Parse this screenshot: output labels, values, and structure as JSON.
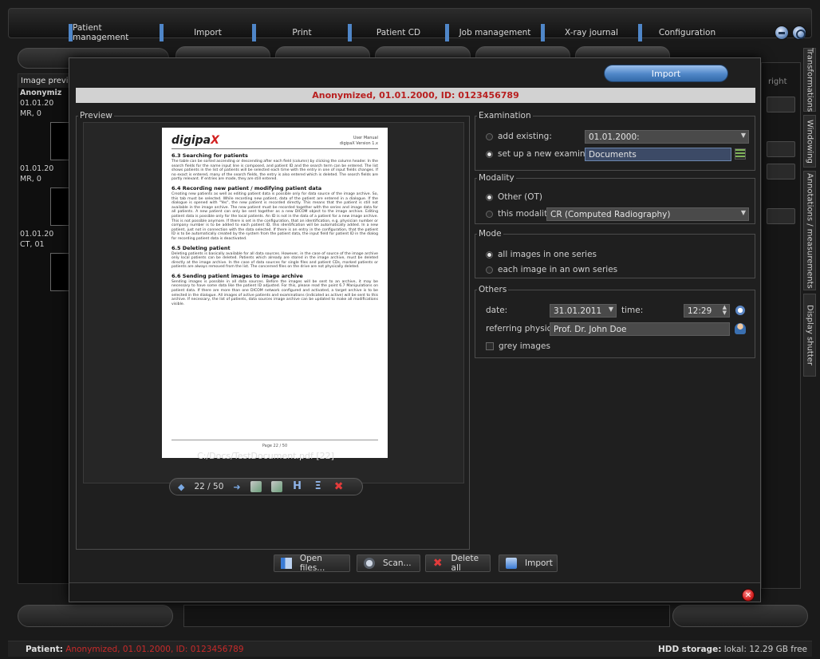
{
  "top_menu": {
    "items": [
      {
        "label": "Patient management"
      },
      {
        "label": "Import"
      },
      {
        "label": "Print"
      },
      {
        "label": "Patient CD"
      },
      {
        "label": "Job management"
      },
      {
        "label": "X-ray journal"
      },
      {
        "label": "Configuration"
      }
    ]
  },
  "left_panel": {
    "title": "Image preview",
    "items": [
      "Anonymiz",
      "01.01.20",
      "MR, 0",
      "01.01.20",
      "MR, 0",
      "01.01.20",
      "CT, 01"
    ]
  },
  "right_tabs": [
    "Transformations",
    "Windowing",
    "Annotations / measurements",
    "Display shutter"
  ],
  "right_panel_text": "right",
  "dialog": {
    "tab_label": "Import",
    "header": "Anonymized, 01.01.2000, ID: 0123456789",
    "preview": {
      "legend": "Preview",
      "file_path": "C:/Docs/TestDocument.pdf [22]",
      "page_indicator": "22 / 50",
      "document": {
        "logo_main": "digipa",
        "logo_x": "X",
        "header_right": "User Manual\ndigipaX Version 1.x",
        "sections": [
          {
            "title": "6.3 Searching for patients",
            "text": "The table can be sorted ascending or descending after each field (column) by clicking the column header. In the search fields for the name input line is composed, and patient ID and the search term can be entered. The list shows patients in the list of patients will be selected each time with the entry in one of input fields changes. If no exact is entered, many of the search fields, the entry is also entered which is deleted. The search fields are partly relevant. If entries are made, they are still entered."
          },
          {
            "title": "6.4 Recording new patient / modifying patient data",
            "text": "Creating new patients as well as editing patient data is possible only for data source of the image archive. So, this tab must be selected. While recording new patient, data of the patient are entered in a dialogue. If the dialogue is opened with \"Yes\", the new patient is recorded directly. This means that the patient is still not available in the image archive. The new patient must be recorded together with the series and image data for all patients. A new patient can only be sent together as a new DICOM object to the image archive. Editing patient data is possible only for the local patients. An ID is not in the data of a patient for a new image archive. This is not possible anymore. If there is set in the configuration, that an identification, e.g. physician number or company number is to be added to each patient ID, this identification will be automatically added. In a new patient, just not in connection with the data selected. If there is an entry in the configuration, that the patient ID is to be automatically created by the system from the patient data, the input field for patient ID in the dialog for recording patient data is deactivated."
          },
          {
            "title": "6.5 Deleting patient",
            "text": "Deleting patients is basically available for all data sources. However, in the case of source of the image archive only local patients can be deleted. Patients which already are stored in the image archive, must be deleted directly at the image archive. In the case of data sources for single files and patient CDs, marked patients or patients are always removed from the list. The concerned files on the drive are not physically deleted."
          },
          {
            "title": "6.6 Sending patient images to image archive",
            "text": "Sending images is possible in all data sources. Before the images will be sent to an archive, it may be necessary to have some data like the patient ID adjusted. For this, please read the point 6.7 Manipulations on patient data. If there are more than one DICOM network configured and activated, a target archive is to be selected in the dialogue. All images of active patients and examinations (indicated as active) will be sent to this archive. If necessary, the list of patients, data sources image archive can be updated to make all modifications visible."
          }
        ],
        "footer": "Page 22 / 50"
      }
    },
    "examination": {
      "legend": "Examination",
      "add_existing_label": "add existing:",
      "add_existing_value": "01.01.2000:",
      "new_exam_label": "set up a new examination:",
      "new_exam_value": "Documents"
    },
    "modality": {
      "legend": "Modality",
      "other_label": "Other (OT)",
      "this_modality_label": "this modality:",
      "this_modality_value": "CR (Computed Radiography)"
    },
    "mode": {
      "legend": "Mode",
      "option1": "all images in one series",
      "option2": "each image in an own series"
    },
    "others": {
      "legend": "Others",
      "date_label": "date:",
      "date_value": "31.01.2011",
      "time_label": "time:",
      "time_value": "12:29",
      "physician_label": "referring physician:",
      "physician_value": "Prof. Dr. John Doe",
      "grey_label": "grey images"
    },
    "buttons": {
      "open_files": "Open files...",
      "scan": "Scan...",
      "delete_all": "Delete all",
      "import": "Import"
    }
  },
  "status": {
    "patient_label": "Patient:",
    "patient_value": "Anonymized, 01.01.2000, ID: 0123456789",
    "storage_label": "HDD storage:",
    "storage_value": "lokal: 12.29 GB free"
  },
  "colors": {
    "accent": "#4f86c8",
    "alert": "#c82a2a"
  }
}
